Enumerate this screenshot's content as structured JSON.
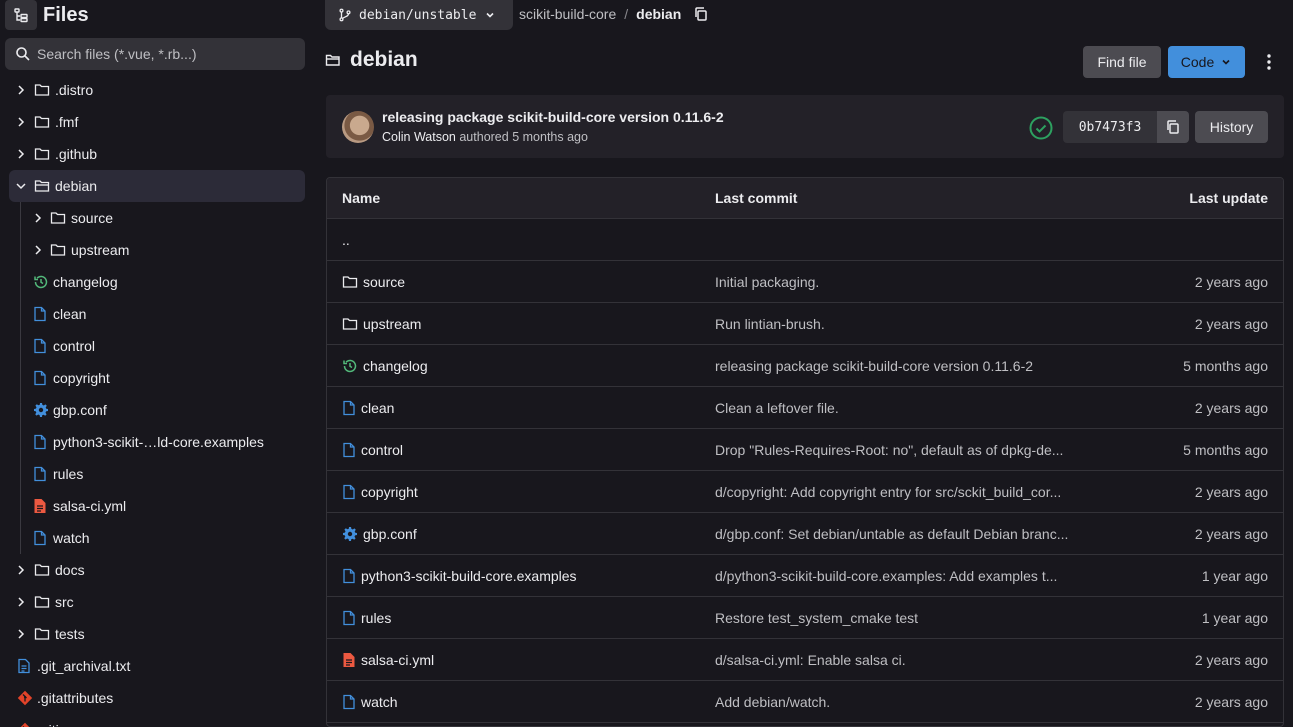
{
  "sidebar": {
    "title": "Files",
    "search_placeholder": "Search files (*.vue, *.rb...)",
    "items": [
      {
        "label": ".distro",
        "kind": "folder",
        "icon": "folder-icon"
      },
      {
        "label": ".fmf",
        "kind": "folder",
        "icon": "folder-icon"
      },
      {
        "label": ".github",
        "kind": "folder",
        "icon": "folder-icon"
      },
      {
        "label": "debian",
        "kind": "folder-open",
        "icon": "folder-open-icon"
      },
      {
        "label": "source",
        "kind": "folder",
        "icon": "folder-icon"
      },
      {
        "label": "upstream",
        "kind": "folder",
        "icon": "folder-icon"
      },
      {
        "label": "changelog",
        "kind": "changelog",
        "icon": "history-icon"
      },
      {
        "label": "clean",
        "kind": "file",
        "icon": "file-icon"
      },
      {
        "label": "control",
        "kind": "file",
        "icon": "file-icon"
      },
      {
        "label": "copyright",
        "kind": "file",
        "icon": "file-icon"
      },
      {
        "label": "gbp.conf",
        "kind": "settings",
        "icon": "gear-icon"
      },
      {
        "label": "python3-scikit-…ld-core.examples",
        "kind": "file",
        "icon": "file-icon"
      },
      {
        "label": "rules",
        "kind": "file",
        "icon": "file-icon"
      },
      {
        "label": "salsa-ci.yml",
        "kind": "yaml",
        "icon": "yaml-file-icon"
      },
      {
        "label": "watch",
        "kind": "file",
        "icon": "file-icon"
      },
      {
        "label": "docs",
        "kind": "folder",
        "icon": "folder-icon"
      },
      {
        "label": "src",
        "kind": "folder",
        "icon": "folder-icon"
      },
      {
        "label": "tests",
        "kind": "folder",
        "icon": "folder-icon"
      },
      {
        "label": ".git_archival.txt",
        "kind": "text",
        "icon": "text-file-icon"
      },
      {
        "label": ".gitattributes",
        "kind": "git",
        "icon": "git-icon"
      },
      {
        "label": ".gitignore",
        "kind": "git",
        "icon": "git-icon"
      }
    ]
  },
  "topbar": {
    "branch": "debian/unstable",
    "breadcrumb": [
      "scikit-build-core",
      "debian"
    ],
    "separator": "/"
  },
  "page": {
    "title": "debian",
    "find_file_label": "Find file",
    "code_label": "Code"
  },
  "commit": {
    "message": "releasing package scikit-build-core version 0.11.6-2",
    "author": "Colin Watson",
    "action": "authored",
    "time": "5 months ago",
    "sha": "0b7473f3",
    "history_label": "History"
  },
  "table": {
    "headers": {
      "name": "Name",
      "last_commit": "Last commit",
      "last_update": "Last update"
    },
    "parent": "..",
    "rows": [
      {
        "name": "source",
        "icon": "folder-icon",
        "commit": "Initial packaging.",
        "date": "2 years ago"
      },
      {
        "name": "upstream",
        "icon": "folder-icon",
        "commit": "Run lintian-brush.",
        "date": "2 years ago"
      },
      {
        "name": "changelog",
        "icon": "history-icon",
        "commit": "releasing package scikit-build-core version 0.11.6-2",
        "date": "5 months ago"
      },
      {
        "name": "clean",
        "icon": "file-icon",
        "commit": "Clean a leftover file.",
        "date": "2 years ago"
      },
      {
        "name": "control",
        "icon": "file-icon",
        "commit": "Drop \"Rules-Requires-Root: no\", default as of dpkg-de...",
        "date": "5 months ago"
      },
      {
        "name": "copyright",
        "icon": "file-icon",
        "commit": "d/copyright: Add copyright entry for src/sckit_build_cor...",
        "date": "2 years ago"
      },
      {
        "name": "gbp.conf",
        "icon": "gear-icon",
        "commit": "d/gbp.conf: Set debian/untable as default Debian branc...",
        "date": "2 years ago"
      },
      {
        "name": "python3-scikit-build-core.examples",
        "icon": "file-icon",
        "commit": "d/python3-scikit-build-core.examples: Add examples t...",
        "date": "1 year ago"
      },
      {
        "name": "rules",
        "icon": "file-icon",
        "commit": "Restore test_system_cmake test",
        "date": "1 year ago"
      },
      {
        "name": "salsa-ci.yml",
        "icon": "yaml-file-icon",
        "commit": "d/salsa-ci.yml: Enable salsa ci.",
        "date": "2 years ago"
      },
      {
        "name": "watch",
        "icon": "file-icon",
        "commit": "Add debian/watch.",
        "date": "2 years ago"
      }
    ]
  },
  "colors": {
    "accent": "#428fdc",
    "success": "#2da160",
    "changelog": "#52b87a",
    "yaml": "#ec5941",
    "git": "#e24329",
    "file": "#428fdc"
  }
}
